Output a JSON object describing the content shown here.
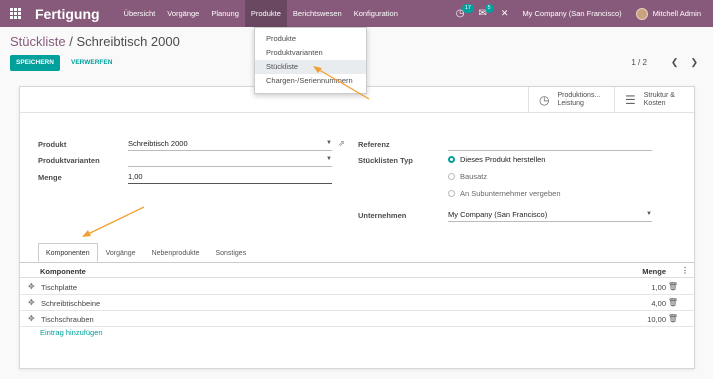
{
  "nav": {
    "brand": "Fertigung",
    "menu": [
      "Übersicht",
      "Vorgänge",
      "Planung",
      "Produkte",
      "Berichtswesen",
      "Konfiguration"
    ],
    "activity_badge": "17",
    "messages_badge": "5",
    "company": "My Company (San Francisco)",
    "user": "Mitchell Admin"
  },
  "dropdown": {
    "items": [
      "Produkte",
      "Produktvarianten",
      "Stückliste",
      "Chargen-/Seriennummern"
    ]
  },
  "breadcrumb": {
    "parent": "Stückliste",
    "separator": " / ",
    "current": "Schreibtisch 2000"
  },
  "buttons": {
    "save": "SPEICHERN",
    "discard": "VERWERFEN"
  },
  "pager": {
    "value": "1 / 2",
    "prev": "❮",
    "next": "❯"
  },
  "smart_buttons": {
    "production": {
      "line1": "Produktions...",
      "line2": "Leistung"
    },
    "structure": {
      "line1": "Struktur &",
      "line2": "Kosten"
    }
  },
  "form": {
    "product_label": "Produkt",
    "product_value": "Schreibtisch 2000",
    "variants_label": "Produktvarianten",
    "variants_value": "",
    "quantity_label": "Menge",
    "quantity_value": "1,00",
    "reference_label": "Referenz",
    "reference_value": "",
    "bom_type_label": "Stücklisten Typ",
    "bom_type_options": [
      "Dieses Produkt herstellen",
      "Bausatz",
      "An Subunternehmer vergeben"
    ],
    "company_label": "Unternehmen",
    "company_value": "My Company (San Francisco)"
  },
  "tabs": [
    "Komponenten",
    "Vorgänge",
    "Nebenprodukte",
    "Sonstiges"
  ],
  "table": {
    "headers": {
      "component": "Komponente",
      "quantity": "Menge"
    },
    "rows": [
      {
        "component": "Tischplatte",
        "quantity": "1,00"
      },
      {
        "component": "Schreibtischbeine",
        "quantity": "4,00"
      },
      {
        "component": "Tischschrauben",
        "quantity": "10,00"
      }
    ],
    "add_line": "Eintrag hinzufügen"
  },
  "colors": {
    "nav": "#875a7b",
    "accent": "#00a09d",
    "annotation_arrow": "#f0a030"
  }
}
